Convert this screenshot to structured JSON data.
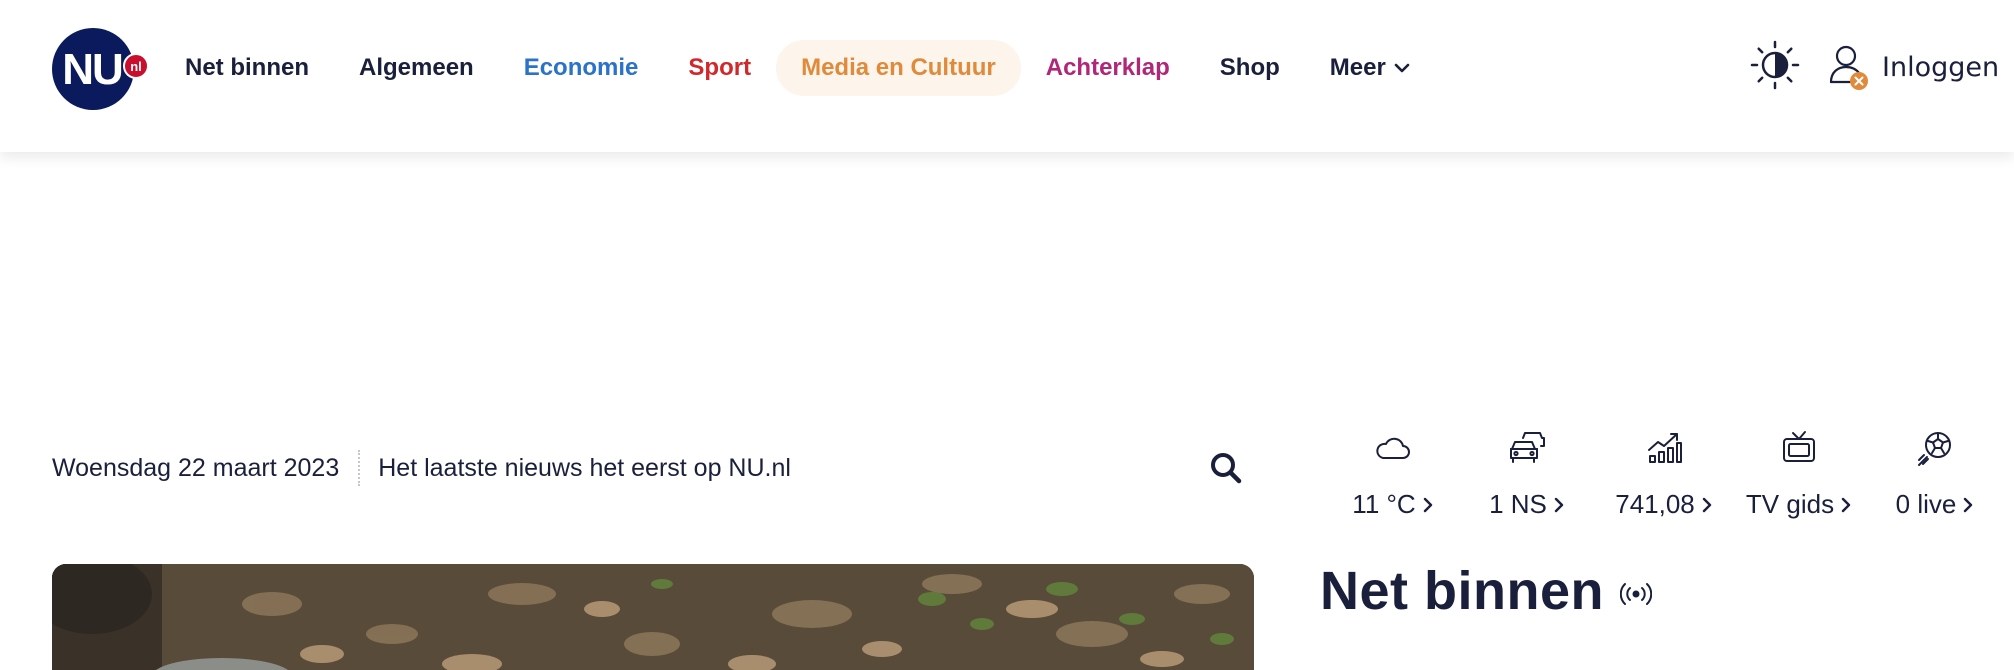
{
  "header": {
    "logo": {
      "text": "NU",
      "badge": "nl",
      "colors": {
        "circle": "#0a1a5c",
        "badge": "#c8102e",
        "text": "#ffffff"
      }
    },
    "nav": [
      {
        "label": "Net binnen",
        "color": "#1a1f3c"
      },
      {
        "label": "Algemeen",
        "color": "#1a1f3c"
      },
      {
        "label": "Economie",
        "color": "#2b72c9"
      },
      {
        "label": "Sport",
        "color": "#d0282b"
      },
      {
        "label": "Media en Cultuur",
        "color": "#e08a3c",
        "active": true
      },
      {
        "label": "Achterklap",
        "color": "#b0277a"
      },
      {
        "label": "Shop",
        "color": "#1a1f3c"
      },
      {
        "label": "Meer",
        "color": "#1a1f3c",
        "icon": "chevron-down-icon"
      }
    ],
    "theme_toggle_icon": "half-sun-icon",
    "login": {
      "label": "Inloggen",
      "icon": "user-icon",
      "badge_icon": "close-badge-icon",
      "badge_color": "#e08a3c"
    }
  },
  "datebar": {
    "date": "Woensdag 22 maart 2023",
    "tagline": "Het laatste nieuws het eerst op NU.nl",
    "search_icon": "search-icon"
  },
  "widgets": [
    {
      "icon": "cloud-icon",
      "label": "11 °C"
    },
    {
      "icon": "traffic-icon",
      "label": "1 NS"
    },
    {
      "icon": "stock-chart-icon",
      "label": "741,08"
    },
    {
      "icon": "tv-icon",
      "label": "TV gids"
    },
    {
      "icon": "soccer-ball-icon",
      "label": "0 live"
    }
  ],
  "section": {
    "title": "Net binnen",
    "icon": "live-broadcast-icon"
  },
  "colors": {
    "text": "#1a1f3c",
    "active_pill": "#fdf4eb"
  }
}
